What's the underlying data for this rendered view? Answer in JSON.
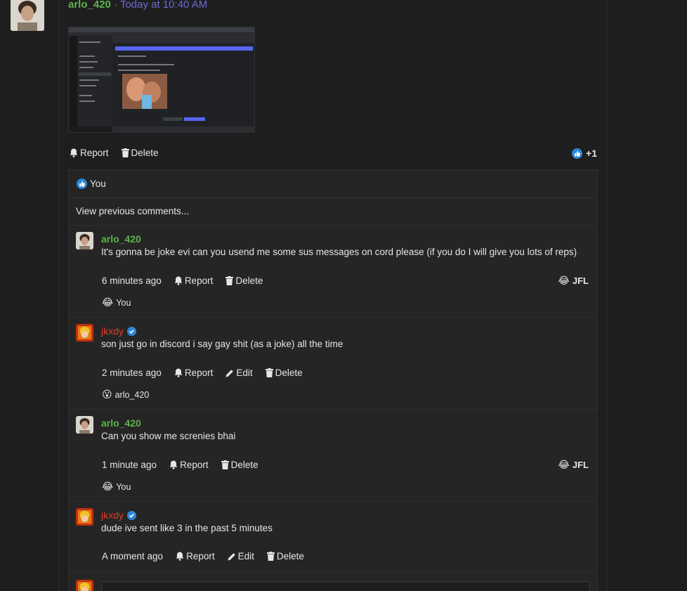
{
  "post": {
    "author": "arlo_420",
    "separator": "·",
    "time": "Today at 10:40 AM",
    "actions": {
      "report": "Report",
      "delete": "Delete"
    },
    "reaction_count": "+1"
  },
  "likes": {
    "label": "You"
  },
  "view_previous": "View previous comments...",
  "comments": [
    {
      "author": "arlo_420",
      "text": "It's gonna be joke evi can you usend me some sus messages on cord please (if you do I will give you lots of reps)",
      "time": "6 minutes ago",
      "report": "Report",
      "delete": "Delete",
      "right_reaction": "JFL",
      "reaction_user": "You"
    },
    {
      "author": "jkxdy",
      "text": "son just go in discord i say gay shit (as a joke) all the time",
      "time": "2 minutes ago",
      "report": "Report",
      "edit": "Edit",
      "delete": "Delete",
      "reaction_user": "arlo_420"
    },
    {
      "author": "arlo_420",
      "text": "Can you show me screnies bhai",
      "time": "1 minute ago",
      "report": "Report",
      "delete": "Delete",
      "right_reaction": "JFL",
      "reaction_user": "You"
    },
    {
      "author": "jkxdy",
      "text": "dude ive sent like 3 in the past 5 minutes",
      "time": "A moment ago",
      "report": "Report",
      "edit": "Edit",
      "delete": "Delete"
    }
  ],
  "colors": {
    "green_name": "#5fb34a",
    "red_name": "#e53a25",
    "link_blue": "#6b6bd6",
    "like_blue": "#2b88d8"
  }
}
